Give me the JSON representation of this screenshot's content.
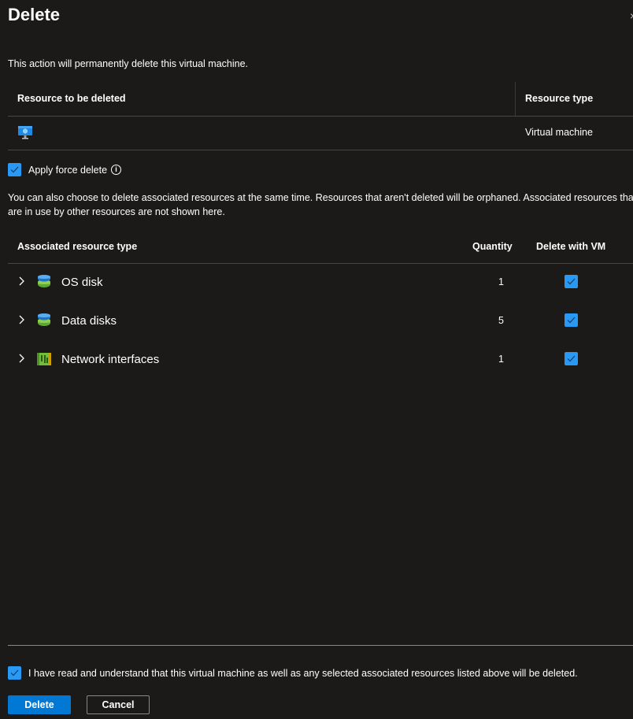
{
  "dialog": {
    "title": "Delete",
    "description": "This action will permanently delete this virtual machine."
  },
  "resource_table": {
    "headers": [
      "Resource to be deleted",
      "Resource type"
    ],
    "rows": [
      {
        "icon": "virtual-machine-icon",
        "name": "",
        "type": "Virtual machine"
      }
    ]
  },
  "force_delete": {
    "label": "Apply force delete",
    "checked": true,
    "info_icon": "info-icon"
  },
  "associated_note": "You can also choose to delete associated resources at the same time. Resources that aren't deleted will be orphaned. Associated resources that are in use by other resources are not shown here.",
  "associated_table": {
    "headers": [
      "Associated resource type",
      "Quantity",
      "Delete with VM"
    ],
    "rows": [
      {
        "icon": "disk-icon",
        "name": "OS disk",
        "quantity": "1",
        "delete_with_vm": true
      },
      {
        "icon": "disk-icon",
        "name": "Data disks",
        "quantity": "5",
        "delete_with_vm": true
      },
      {
        "icon": "network-interface-icon",
        "name": "Network interfaces",
        "quantity": "1",
        "delete_with_vm": true
      }
    ]
  },
  "acknowledgement": {
    "label": "I have read and understand that this virtual machine as well as any selected associated resources listed above will be deleted.",
    "checked": true
  },
  "buttons": {
    "delete_label": "Delete",
    "cancel_label": "Cancel"
  },
  "colors": {
    "background": "#1b1a19",
    "primary": "#0078d4",
    "checkbox": "#2899f5"
  }
}
